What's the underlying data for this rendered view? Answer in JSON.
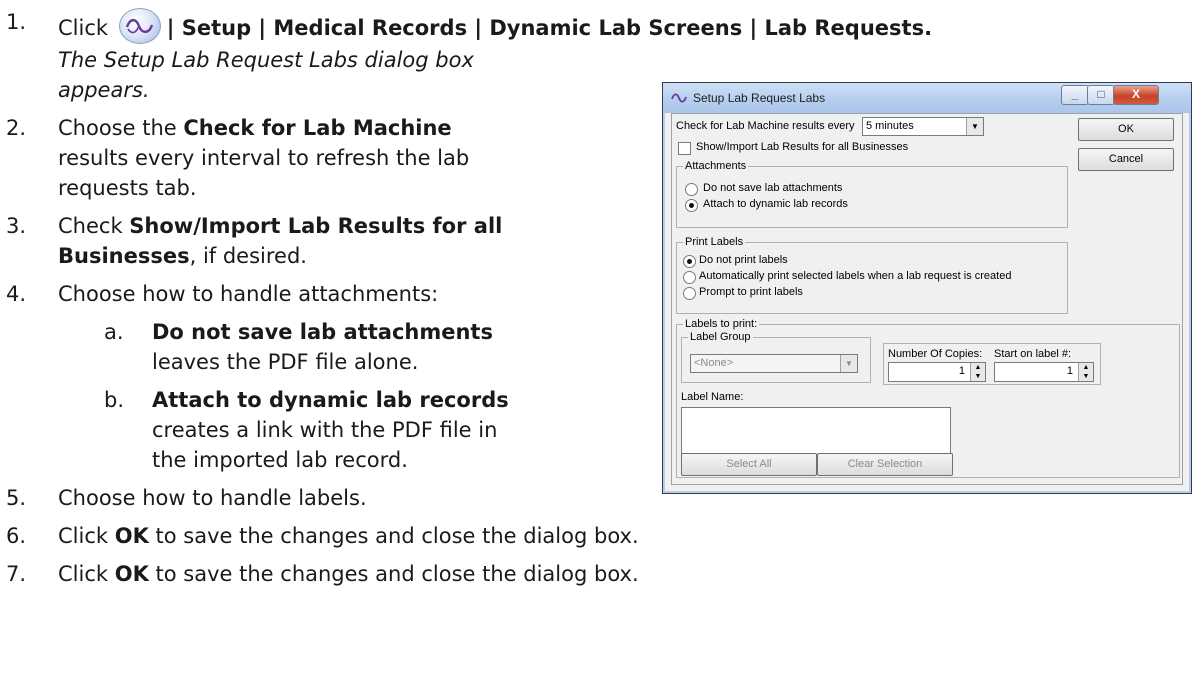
{
  "steps": {
    "s1": {
      "num": "1.",
      "pre": "Click",
      "path": "| Setup | Medical Records | Dynamic Lab Screens | Lab Requests",
      "end": ".",
      "icon": "app-logo-icon"
    },
    "s1_note_1": "The Setup Lab Request Labs dialog box",
    "s1_note_2": "appears.",
    "s2": {
      "num": "2.",
      "pre": "Choose the",
      "bold": "Check for Lab Machine",
      "l2": "results every interval to refresh the lab",
      "l3": "requests tab."
    },
    "s3": {
      "num": "3.",
      "pre": "Check",
      "bold": "Show/Import Lab Results for all",
      "bold2": "Businesses",
      "post": ", if desired."
    },
    "s4": {
      "num": "4.",
      "text": "Choose how to handle attachments:"
    },
    "s4a": {
      "num": "a.",
      "bold": "Do not save lab attachments",
      "l2": "leaves the PDF file alone."
    },
    "s4b": {
      "num": "b.",
      "bold": "Attach to dynamic lab records",
      "l2": "creates a link with the PDF file in",
      "l3": "the imported lab record."
    },
    "s5": {
      "num": "5.",
      "text": "Choose how to handle labels."
    },
    "s6": {
      "num": "6.",
      "pre": "Click",
      "bold": "OK",
      "post": "to save the changes and close the dialog box."
    },
    "s7": {
      "num": "7.",
      "pre": "Click",
      "bold": "OK",
      "post": "to save the changes and close the dialog box."
    }
  },
  "dialog": {
    "title": "Setup Lab Request Labs",
    "check_interval_label": "Check for Lab Machine results every",
    "check_interval_value": "5 minutes",
    "ok": "OK",
    "cancel": "Cancel",
    "show_import_label": "Show/Import Lab Results for all Businesses",
    "attachments_group": "Attachments",
    "attach_opt1": "Do not save lab attachments",
    "attach_opt2": "Attach to dynamic lab records",
    "print_labels_group": "Print Labels",
    "print_opt1": "Do not print labels",
    "print_opt2": "Automatically print selected labels when a lab request is created",
    "print_opt3": "Prompt to print labels",
    "labels_to_print_group": "Labels to print:",
    "label_group_group": "Label Group",
    "label_group_value": "<None>",
    "copies_label": "Number Of Copies:",
    "copies_value": "1",
    "start_label": "Start on label #:",
    "start_value": "1",
    "label_name_label": "Label Name:",
    "select_all": "Select All",
    "clear_selection": "Clear Selection",
    "close_glyph": "X",
    "min_glyph": "_",
    "max_glyph": "□"
  }
}
